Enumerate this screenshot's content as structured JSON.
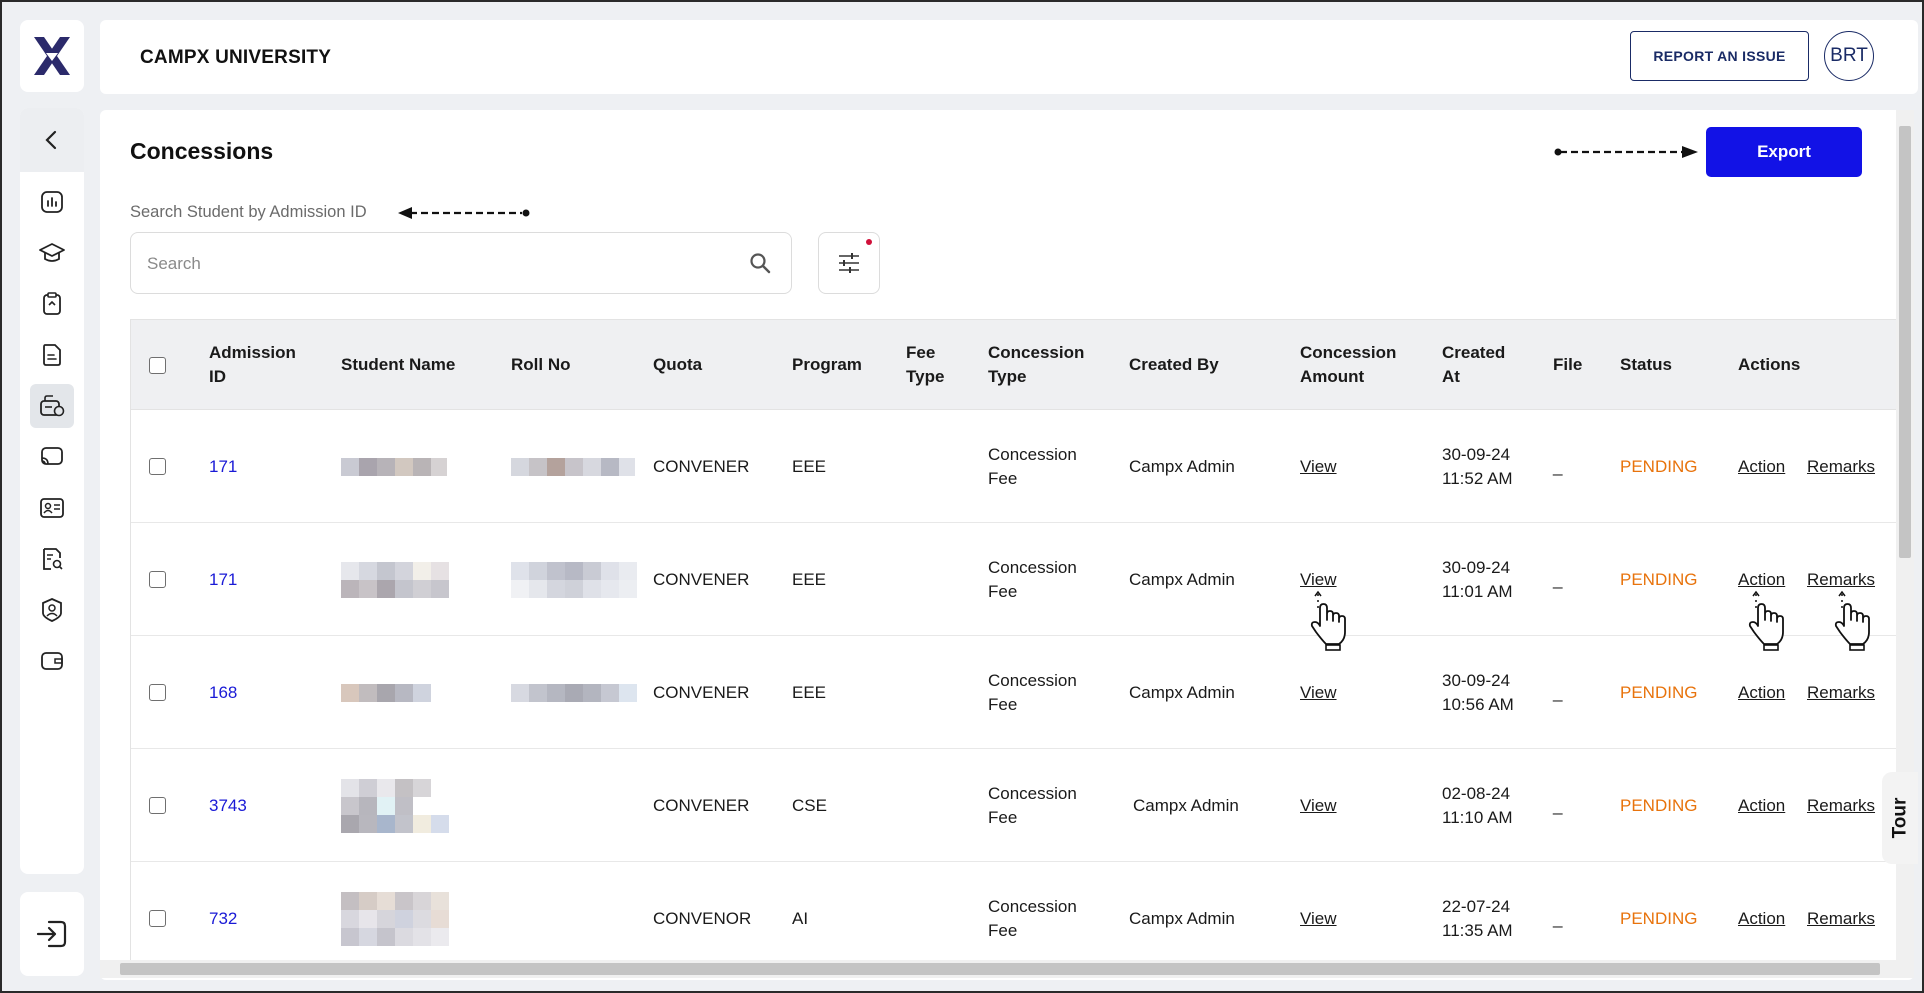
{
  "app": {
    "brand": "CAMPX UNIVERSITY"
  },
  "header": {
    "report_label": "REPORT AN ISSUE",
    "avatar_initials": "BRT"
  },
  "page": {
    "title": "Concessions",
    "export_label": "Export",
    "search_label": "Search Student by Admission ID",
    "search_placeholder": "Search"
  },
  "table": {
    "headers": {
      "admission_id": "Admission ID",
      "student_name": "Student Name",
      "roll_no": "Roll No",
      "quota": "Quota",
      "program": "Program",
      "fee_type": "Fee Type",
      "concession_type": "Concession Type",
      "created_by": "Created By",
      "concession_amount": "Concession Amount",
      "created_at": "Created At",
      "file": "File",
      "status": "Status",
      "actions": "Actions"
    },
    "rows": [
      {
        "admission_id": "171",
        "quota": "CONVENER",
        "program": "EEE",
        "fee_type": "",
        "concession_type": "Concession Fee",
        "created_by": "Campx Admin",
        "amount_link": "View",
        "created_at": "30-09-24 11:52 AM",
        "file": "_",
        "status": "PENDING",
        "action": "Action",
        "remarks": "Remarks"
      },
      {
        "admission_id": "171",
        "quota": "CONVENER",
        "program": "EEE",
        "fee_type": "",
        "concession_type": "Concession Fee",
        "created_by": "Campx Admin",
        "amount_link": "View",
        "created_at": "30-09-24 11:01 AM",
        "file": "_",
        "status": "PENDING",
        "action": "Action",
        "remarks": "Remarks"
      },
      {
        "admission_id": "168",
        "quota": "CONVENER",
        "program": "EEE",
        "fee_type": "",
        "concession_type": "Concession Fee",
        "created_by": "Campx Admin",
        "amount_link": "View",
        "created_at": "30-09-24 10:56 AM",
        "file": "_",
        "status": "PENDING",
        "action": "Action",
        "remarks": "Remarks"
      },
      {
        "admission_id": "3743",
        "quota": "CONVENER",
        "program": "CSE",
        "fee_type": "",
        "concession_type": "Concession Fee",
        "created_by": "Campx Admin",
        "amount_link": "View",
        "created_at": "02-08-24 11:10 AM",
        "file": "_",
        "status": "PENDING",
        "action": "Action",
        "remarks": "Remarks"
      },
      {
        "admission_id": "732",
        "quota": "CONVENOR",
        "program": "AI",
        "fee_type": "",
        "concession_type": "Concession Fee",
        "created_by": "Campx Admin",
        "amount_link": "View",
        "created_at": "22-07-24 11:35 AM",
        "file": "_",
        "status": "PENDING",
        "action": "Action",
        "remarks": "Remarks"
      }
    ]
  },
  "tour_label": "Tour",
  "colors": {
    "accent": "#1212e6",
    "status_pending": "#e8730c",
    "link_blue": "#1a1ad6",
    "brand_navy": "#2b2a6b"
  }
}
